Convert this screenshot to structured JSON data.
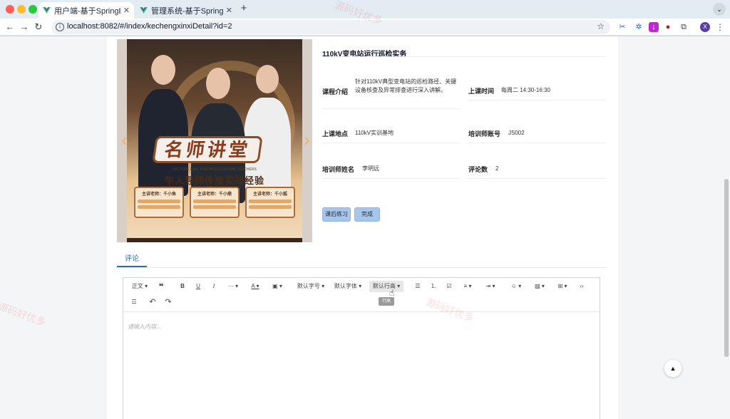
{
  "browser": {
    "tabs": [
      {
        "title": "用户端-基于SpringBoot的电力"
      },
      {
        "title": "管理系统-基于SpringBoot的电"
      }
    ],
    "url": "localhost:8082/#/index/kechengxinxiDetail?id=2",
    "profile_initial": "X"
  },
  "poster": {
    "banner_text": "名师讲堂",
    "en_text": "LECTURE HALL FOR PROFESSIONAL TEACHERS",
    "subtitle": "牛人导师传授实战经验",
    "speakers": [
      "主讲老师：千小鱼",
      "主讲老师：千小鼎",
      "主讲老师：千小狐"
    ]
  },
  "detail": {
    "title": "110kV变电站运行巡检实务",
    "fields": [
      {
        "label": "课程介绍",
        "value": "针对110kV典型变电站的巡检路径、关键设备核查及异常排查进行深入讲解。"
      },
      {
        "label": "上课时间",
        "value": "每周二 14:30-16:30"
      },
      {
        "label": "上课地点",
        "value": "110kV实训基地"
      },
      {
        "label": "培训师账号",
        "value": "JS002"
      },
      {
        "label": "培训师姓名",
        "value": "李明远"
      },
      {
        "label": "评论数",
        "value": "2"
      }
    ],
    "buttons": {
      "practice": "课后练习",
      "complete": "完成"
    }
  },
  "comment_tab": "评论",
  "editor": {
    "toolbar": {
      "paragraph": "正文",
      "font_size": "默认字号",
      "font_family": "默认字体",
      "line_height": "默认行高"
    },
    "tooltip": "行高",
    "placeholder": "请输入内容..."
  },
  "watermark": "源码好优多",
  "colors": {
    "accent": "#2b6cb0",
    "button": "#a8c6ec"
  }
}
